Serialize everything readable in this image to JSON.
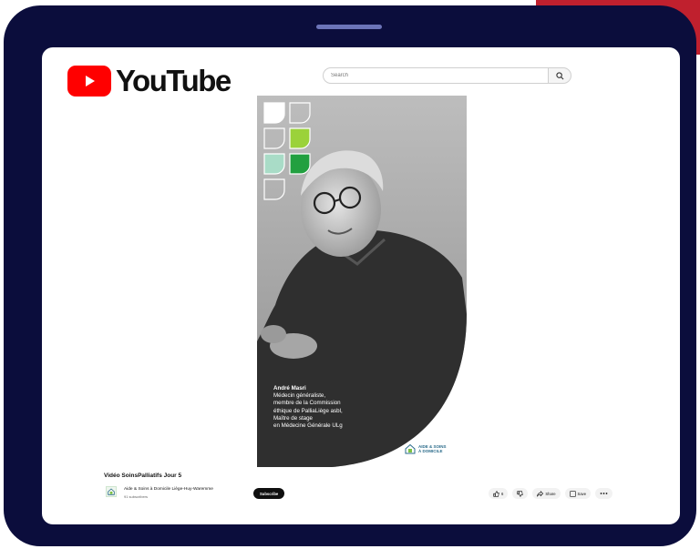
{
  "app": {
    "logo_text": "YouTube"
  },
  "search": {
    "placeholder": "Search"
  },
  "video": {
    "caption": {
      "name": "André Masri",
      "lines": [
        "Médecin généraliste,",
        "membre de la Commission",
        "éthique de PalliaLiège asbl,",
        "Maître de stage",
        "en Médecine Générale ULg"
      ]
    },
    "watermark": {
      "line1": "AIDE & SOINS",
      "line2": "À DOMICILE"
    }
  },
  "meta": {
    "title": "Vidéo SoinsPalliatifs Jour 5",
    "channel_name": "Aide & Soins à Domicile Liège-Huy-Waremme",
    "subscribers": "91 subscribers",
    "subscribe_label": "Subscribe",
    "like_count": "6",
    "share_label": "Share",
    "save_label": "Save"
  },
  "colors": {
    "frame": "#0b0d3c",
    "accent": "#c0202e",
    "youtube_red": "#ff0000"
  }
}
